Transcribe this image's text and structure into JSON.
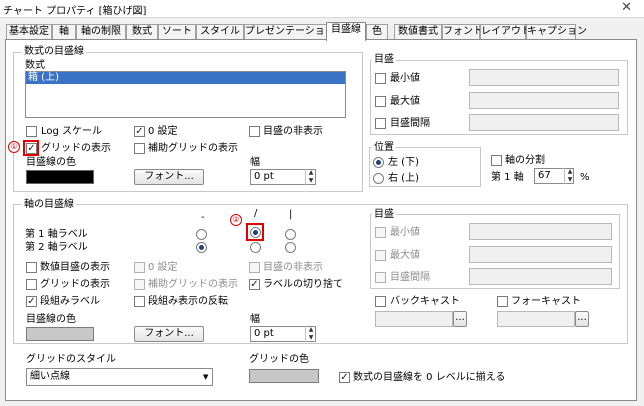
{
  "window": {
    "title": "チャート プロパティ [箱ひげ図]",
    "close_glyph": "✕"
  },
  "tabs": [
    {
      "label": "基本設定"
    },
    {
      "label": "軸"
    },
    {
      "label": "軸の制限"
    },
    {
      "label": "数式"
    },
    {
      "label": "ソート"
    },
    {
      "label": "スタイル"
    },
    {
      "label": "プレゼンテーション"
    },
    {
      "label": "目盛線"
    },
    {
      "label": "色"
    },
    {
      "label": "数値書式"
    },
    {
      "label": "フォント"
    },
    {
      "label": "レイアウト"
    },
    {
      "label": "キャプション"
    }
  ],
  "active_tab": "目盛線",
  "expr_group": {
    "title": "数式の目盛線",
    "expr_label": "数式",
    "list_items": [
      "箱 (上)"
    ],
    "log_scale": "Log スケール",
    "zero_setting": "0 設定",
    "hide_gridlines": "目盛の非表示",
    "show_grid": "グリッドの表示",
    "show_minor_grid": "補助グリッドの表示",
    "grid_color_label": "目盛線の色",
    "font_button": "フォント...",
    "width_label": "幅",
    "width_value": "0 pt"
  },
  "scale_group_top": {
    "title": "目盛",
    "min": "最小値",
    "max": "最大値",
    "interval": "目盛間隔"
  },
  "position_group": {
    "title": "位置",
    "left": "左 (下)",
    "right": "右 (上)"
  },
  "axis_split": {
    "label": "軸の分割",
    "first_axis": "第 1 軸",
    "value": "67",
    "unit": "%"
  },
  "axis_group": {
    "title": "軸の目盛線",
    "col_glyphs": [
      "-",
      "/",
      "|"
    ],
    "rows": [
      {
        "label": "第 1 軸ラベル",
        "selected": 1
      },
      {
        "label": "第 2 軸ラベル",
        "selected": 0
      }
    ],
    "show_value_scale": "数値目盛の表示",
    "zero_setting": "0 設定",
    "hide_gridlines": "目盛の非表示",
    "show_grid": "グリッドの表示",
    "show_minor_grid": "補助グリッドの表示",
    "wrap_labels": "ラベルの切り捨て",
    "stagger_labels": "段組みラベル",
    "reverse_stagger": "段組み表示の反転",
    "grid_color_label": "目盛線の色",
    "font_button": "フォント...",
    "width_label": "幅",
    "width_value": "0 pt",
    "backcast": "バックキャスト",
    "forecast": "フォーキャスト",
    "ellipsis": "..."
  },
  "scale_group_bottom": {
    "title": "目盛",
    "min": "最小値",
    "max": "最大値",
    "interval": "目盛間隔"
  },
  "grid_style": {
    "label": "グリッドのスタイル",
    "value": "細い点線",
    "arrow": "▼"
  },
  "grid_color": {
    "label": "グリッドの色"
  },
  "align_zero": {
    "label": "数式の目盛線を 0 レベルに揃える"
  },
  "annotations": {
    "one": "①",
    "two": "②"
  },
  "spin_glyphs": {
    "up": "▲",
    "down": "▼"
  },
  "check_glyph": "✓"
}
